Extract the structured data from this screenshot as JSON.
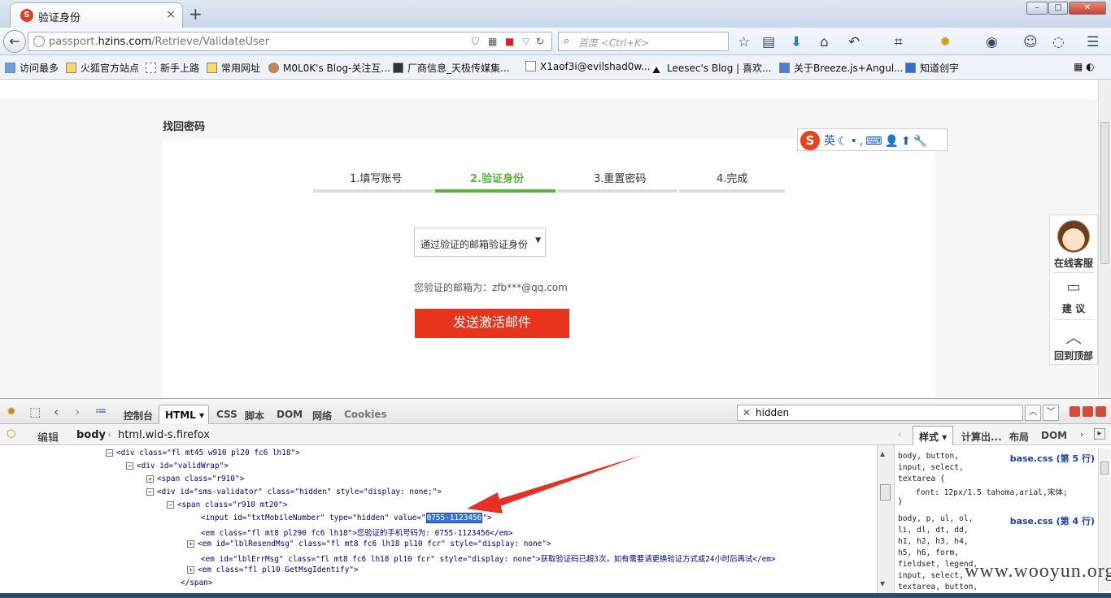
{
  "browser": {
    "tab_title": "验证身份",
    "url_prefix": "passport.",
    "url_domain": "hzins.com",
    "url_path": "/Retrieve/ValidateUser",
    "search_placeholder": "百度 <Ctrl+K>"
  },
  "bookmarks": [
    "访问最多",
    "火狐官方站点",
    "新手上路",
    "常用网址",
    "M0L0K's Blog-关注互...",
    "厂商信息_天极传媒集...",
    "X1aof3i@evilshad0w...",
    "Leesec's Blog | 喜欢...",
    "关于Breeze.js+Angul...",
    "知道创宇"
  ],
  "page": {
    "title": "找回密码",
    "steps": [
      "1.填写账号",
      "2.验证身份",
      "3.重置密码",
      "4.完成"
    ],
    "method_select": "通过验证的邮箱验证身份",
    "email_tip": "您验证的邮箱为：zfb***@qq.com",
    "send_button": "发送激活邮件",
    "ime_label": "英",
    "side": {
      "service": "在线客服",
      "advice": "建 议",
      "top": "回到顶部"
    }
  },
  "firebug": {
    "tabs": [
      "控制台",
      "HTML",
      "CSS",
      "脚本",
      "DOM",
      "网络",
      "Cookies"
    ],
    "search_value": "hidden",
    "edit_label": "编辑",
    "crumb_body": "body",
    "crumb_html": "html.wid-s.firefox",
    "side_tabs": [
      "样式",
      "计算出...",
      "布局",
      "DOM"
    ],
    "code_lines": {
      "l1": "<div class=\"fl mt45 w910 pl20 fc6 lh18\">",
      "l2": "<div id=\"validWrap\">",
      "l3": "<span class=\"r910\">",
      "l4": "<div id=\"sms-validator\" class=\"hidden\" style=\"display: none;\">",
      "l5": "<span class=\"r910 mt20\">",
      "l6a": "<input id=\"txtMobileNumber\" type=\"hidden\" value=\"",
      "l6b": "0755-1123456",
      "l6c": "\">",
      "l7": "<em class=\"fl mt8 pl290 fc6 lh18\">您验证的手机号码为: 0755-1123456</em>",
      "l8": "<em id=\"lblResendMsg\" class=\"fl mt8 fc6 lh18 pl10 fcr\" style=\"display: none\">",
      "l9": "<em id=\"lblErrMsg\" class=\"fl mt8 fc6 lh18 pl10 fcr\" style=\"display: none\">获取验证码已超3次，如有需要请更换验证方式或24小时后再试</em>",
      "l10": "<em class=\"fl pl10 GetMsgIdentify\">",
      "l11": "</span>"
    },
    "css_rules": {
      "r1_sel": [
        "body, button,",
        "input, select,",
        "textarea {"
      ],
      "r1_src": "base.css (第 5 行)",
      "r1_decl": "font: 12px/1.5 tahoma,arial,宋体;",
      "r1_close": "}",
      "r2_sel": [
        "body, p, ul, ol,",
        "li, dl, dt, dd,",
        "h1, h2, h3, h4,",
        "h5, h6, form,",
        "fieldset, legend,",
        "input, select,",
        "textarea, button,"
      ],
      "r2_src": "base.css (第 4 行)"
    }
  },
  "watermark": "www.wooyun.org",
  "colors": {
    "accent_green": "#5cb33f",
    "button_red": "#e8341c",
    "arrow_red": "#e53025"
  }
}
